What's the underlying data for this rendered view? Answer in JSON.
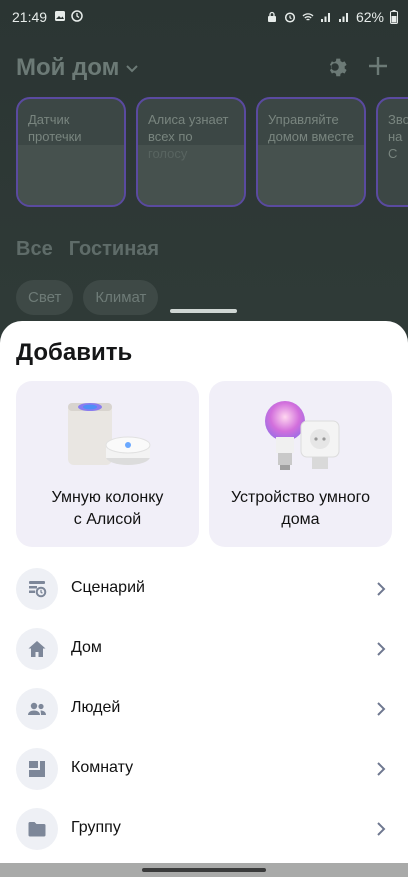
{
  "status_bar": {
    "time": "21:49",
    "battery": "62%"
  },
  "header": {
    "title": "Мой дом"
  },
  "stories": [
    {
      "text": "Датчик протечки"
    },
    {
      "text": "Алиса узнает всех по голосу"
    },
    {
      "text": "Управляйте домом вместе"
    },
    {
      "text": "Зво на С"
    }
  ],
  "room_tabs": [
    "Все",
    "Гостиная"
  ],
  "chips": [
    "Свет",
    "Климат"
  ],
  "sheet": {
    "title": "Добавить",
    "cards": [
      {
        "label": "Умную колонку\nс Алисой"
      },
      {
        "label": "Устройство умного\nдома"
      }
    ],
    "menu": [
      {
        "label": "Сценарий",
        "icon": "scenario-icon"
      },
      {
        "label": "Дом",
        "icon": "house-icon"
      },
      {
        "label": "Людей",
        "icon": "people-icon"
      },
      {
        "label": "Комнату",
        "icon": "room-icon"
      },
      {
        "label": "Группу",
        "icon": "folder-icon"
      }
    ]
  },
  "colors": {
    "sheet_bg": "#ffffff",
    "card_bg": "#f1eff8",
    "icon_bg": "#eef0f5",
    "icon_fg": "#7d8799"
  }
}
